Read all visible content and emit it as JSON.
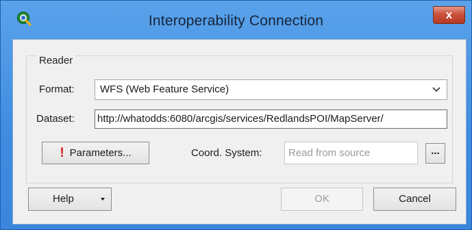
{
  "window": {
    "title": "Interoperability Connection",
    "close_label": "x",
    "icon": "qgis-logo-icon"
  },
  "reader": {
    "group_label": "Reader",
    "format": {
      "label": "Format:",
      "value": "WFS (Web Feature Service)"
    },
    "dataset": {
      "label": "Dataset:",
      "value": "http://whatodds:6080/arcgis/services/RedlandsPOI/MapServer/"
    },
    "parameters": {
      "label": "Parameters...",
      "icon": "exclamation-warning-icon",
      "icon_glyph": "!"
    },
    "coord_system": {
      "label": "Coord. System:",
      "placeholder": "Read from source"
    },
    "browse_label": "..."
  },
  "footer": {
    "help_label": "Help",
    "ok_label": "OK",
    "cancel_label": "Cancel"
  },
  "colors": {
    "title_bar": "#4a93e4",
    "close_button": "#c9513c",
    "warning": "#d11a1a"
  }
}
